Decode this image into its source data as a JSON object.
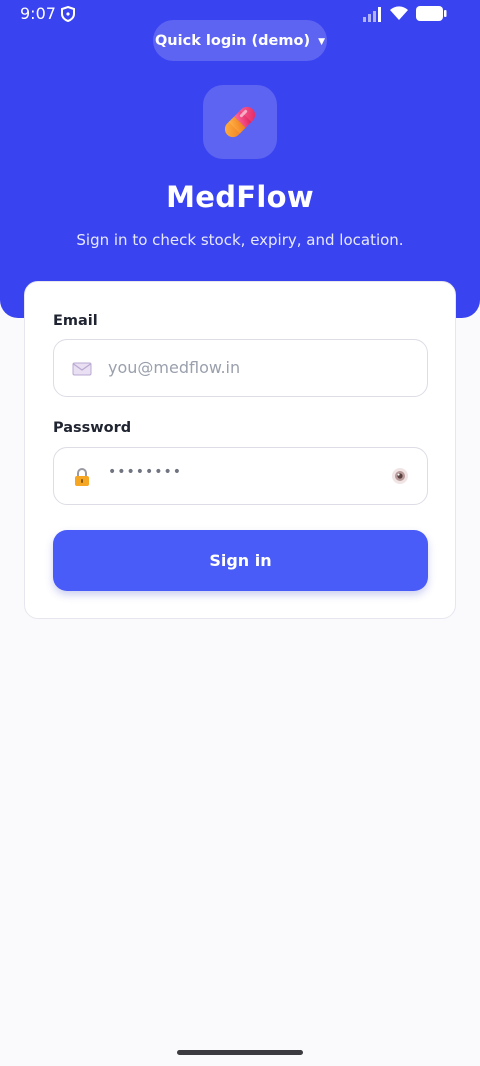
{
  "status_bar": {
    "time": "9:07"
  },
  "header": {
    "quick_login_label": "Quick login (demo)",
    "app_name": "MedFlow",
    "subtitle": "Sign in to check stock, expiry, and location."
  },
  "form": {
    "email_label": "Email",
    "email_placeholder": "you@medflow.in",
    "password_label": "Password",
    "password_value": "••••••••",
    "signin_label": "Sign in"
  },
  "icons": {
    "app_logo": "pill-icon",
    "email": "envelope-icon",
    "password": "lock-icon",
    "toggle_visibility": "eye-icon"
  },
  "colors": {
    "brand": "#3a43f0",
    "button": "#4a5cf8"
  }
}
